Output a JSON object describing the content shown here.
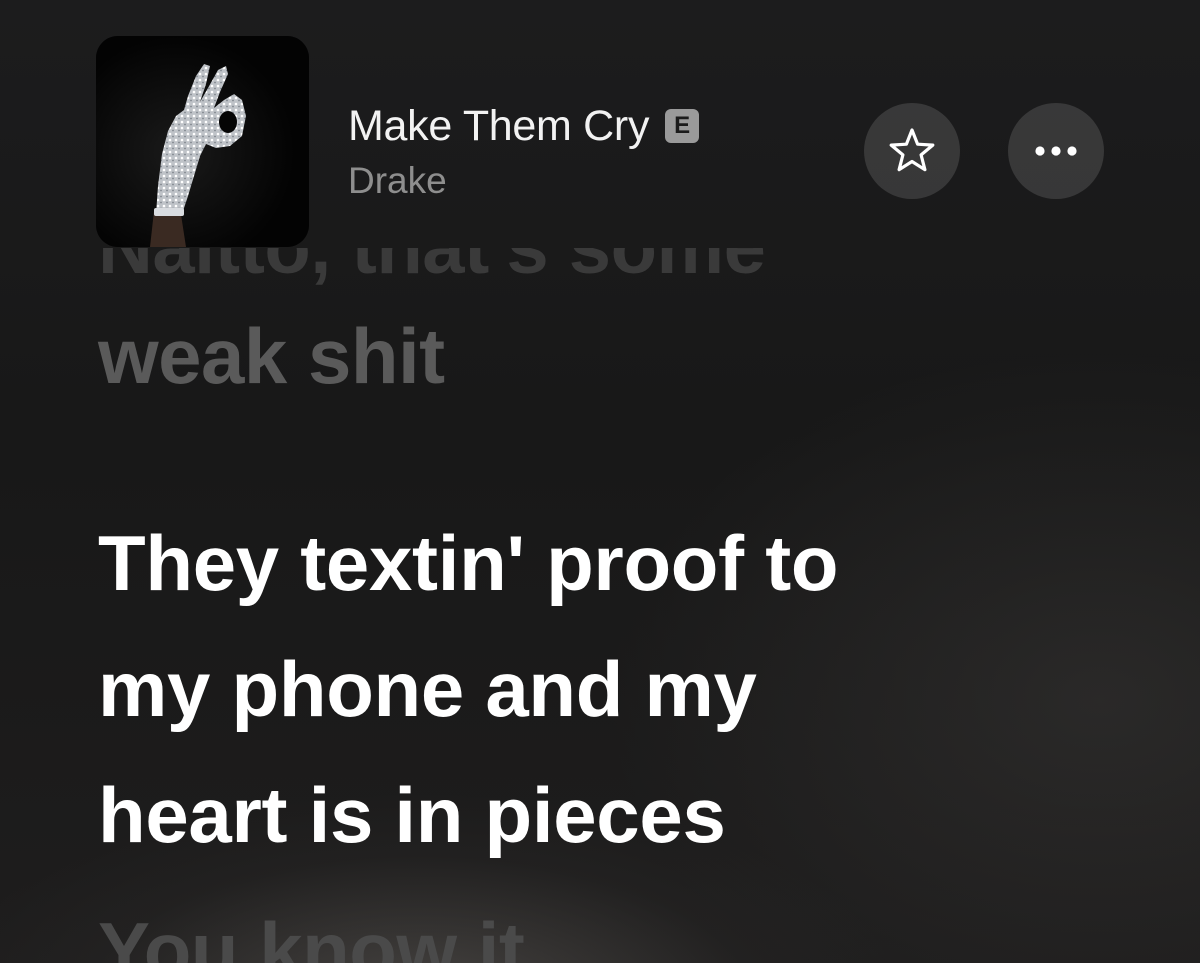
{
  "now_playing": {
    "title": "Make Them Cry",
    "explicit_badge": "E",
    "artist": "Drake"
  },
  "controls": {
    "favorite_icon": "star-outline-icon",
    "more_icon": "ellipsis-icon"
  },
  "lyrics": {
    "previous_clipped": "Naitto, that's some",
    "previous": "weak shit",
    "current_lines": [
      "They textin' proof to",
      "my phone and my",
      "heart is in pieces"
    ],
    "next_clipped": "You know it"
  },
  "colors": {
    "background": "#181818",
    "title": "#f2f2f2",
    "artist": "#8e8e8e",
    "active_lyric": "#ffffff",
    "inactive_lyric": "#5a5a5a",
    "badge": "#9a9a9a"
  }
}
